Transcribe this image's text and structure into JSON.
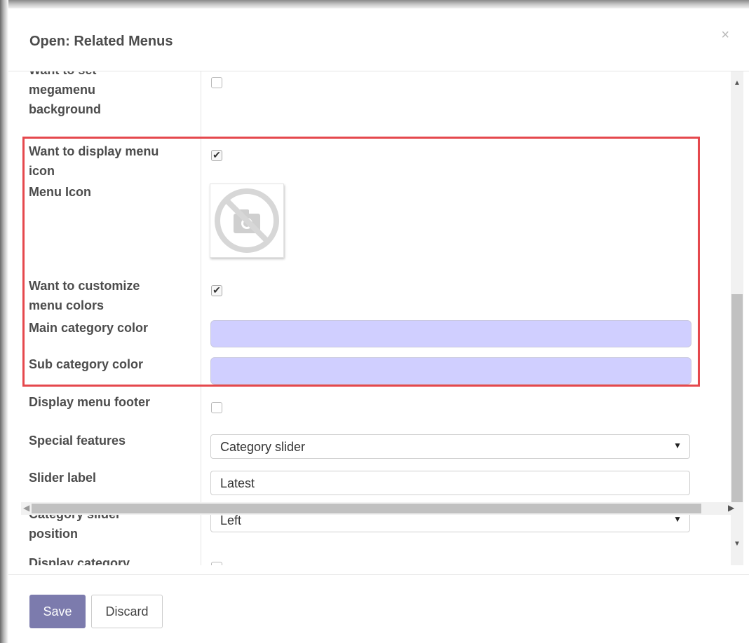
{
  "dialog": {
    "title": "Open: Related Menus",
    "close_glyph": "×"
  },
  "form": {
    "megamenu_bg": {
      "label_line1": "Want to set",
      "label_line2": "megamenu",
      "label_line3": "background",
      "checked": false
    },
    "display_icon": {
      "label_line1": "Want to display menu",
      "label_line2": "icon",
      "checked": true
    },
    "menu_icon": {
      "label": "Menu Icon",
      "placeholder_icon": "camera-slash-icon"
    },
    "customize_colors": {
      "label_line1": "Want to customize",
      "label_line2": "menu colors",
      "checked": true
    },
    "main_category_color": {
      "label": "Main category color",
      "value": "#d0cfff"
    },
    "sub_category_color": {
      "label": "Sub category color",
      "value": "#d0cfff"
    },
    "display_footer": {
      "label": "Display menu footer",
      "checked": false
    },
    "special_features": {
      "label": "Special features",
      "value": "Category slider"
    },
    "slider_label": {
      "label": "Slider label",
      "value": "Latest"
    },
    "slider_position": {
      "label_line1": "Category slider",
      "label_line2": "position",
      "value": "Left"
    },
    "display_category": {
      "label": "Display category"
    }
  },
  "footer": {
    "save_label": "Save",
    "discard_label": "Discard"
  },
  "colors": {
    "highlight": "#e5484d",
    "primary_button": "#7c7bad",
    "color_field": "#d0cfff"
  },
  "icons": {
    "checkbox_tick": "✔",
    "select_arrow": "▼",
    "scroll_up": "▲",
    "scroll_down": "▼",
    "scroll_left": "◀",
    "scroll_right": "▶"
  }
}
